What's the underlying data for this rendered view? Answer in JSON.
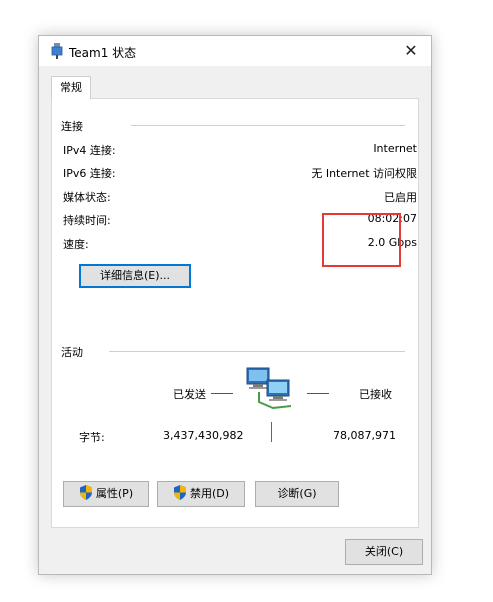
{
  "window": {
    "title": "Team1 状态",
    "close_glyph": "✕",
    "title_icon": "network-adapter-icon"
  },
  "tabs": [
    {
      "label": "常规"
    }
  ],
  "connection": {
    "heading": "连接",
    "rows": [
      {
        "label": "IPv4 连接:",
        "value": "Internet"
      },
      {
        "label": "IPv6 连接:",
        "value": "无 Internet 访问权限"
      },
      {
        "label": "媒体状态:",
        "value": "已启用"
      },
      {
        "label": "持续时间:",
        "value": "08:02:07"
      },
      {
        "label": "速度:",
        "value": "2.0 Gbps"
      }
    ],
    "details_button": "详细信息(E)..."
  },
  "activity": {
    "heading": "活动",
    "sent_label": "已发送",
    "received_label": "已接收",
    "bytes_label": "字节:",
    "bytes_sent": "3,437,430,982",
    "bytes_received": "78,087,971",
    "icon": "network-computers-icon"
  },
  "buttons": {
    "properties": "属性(P)",
    "disable": "禁用(D)",
    "diagnose": "诊断(G)",
    "close": "关闭(C)"
  },
  "colors": {
    "highlight": "#e53935",
    "focus": "#0078d7",
    "shield_blue": "#1e64c8",
    "shield_yellow": "#f2b705"
  }
}
